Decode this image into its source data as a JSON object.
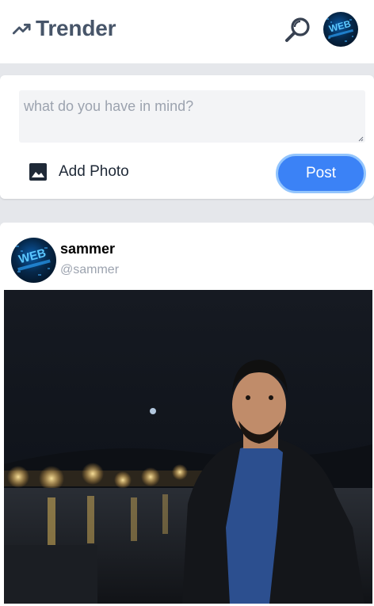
{
  "header": {
    "brand": "Trender",
    "icons": {
      "brand": "trending-up-icon",
      "search": "search-icon",
      "avatar": "user-avatar"
    },
    "avatar_text": "WEB"
  },
  "composer": {
    "placeholder": "what do you have in mind?",
    "add_photo_label": "Add Photo",
    "post_label": "Post"
  },
  "post": {
    "name": "sammer",
    "handle": "@sammer",
    "avatar_text": "WEB"
  },
  "colors": {
    "accent": "#3b82f6",
    "accent_ring": "#93c5fd",
    "brand_text": "#475569",
    "page_bg": "#e5e7eb"
  }
}
